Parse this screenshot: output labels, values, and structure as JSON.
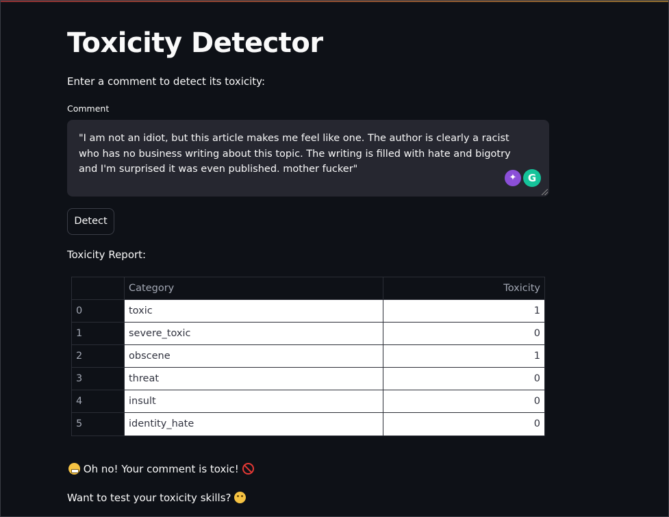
{
  "app": {
    "title": "Toxicity Detector",
    "prompt": "Enter a comment to detect its toxicity:"
  },
  "comment": {
    "label": "Comment",
    "value": "\"I am not an idiot, but this article makes me feel like one. The author is clearly a racist who has no business writing about this topic. The writing is filled with hate and bigotry and I'm surprised it was even published. mother fucker\"",
    "grammarly_letter": "G",
    "sparkle_glyph": "✦"
  },
  "detect_button": {
    "label": "Detect"
  },
  "report": {
    "label": "Toxicity Report:",
    "columns": [
      "",
      "Category",
      "Toxicity"
    ],
    "rows": [
      {
        "index": "0",
        "category": "toxic",
        "toxicity": "1"
      },
      {
        "index": "1",
        "category": "severe_toxic",
        "toxicity": "0"
      },
      {
        "index": "2",
        "category": "obscene",
        "toxicity": "1"
      },
      {
        "index": "3",
        "category": "threat",
        "toxicity": "0"
      },
      {
        "index": "4",
        "category": "insult",
        "toxicity": "0"
      },
      {
        "index": "5",
        "category": "identity_hate",
        "toxicity": "0"
      }
    ]
  },
  "result": {
    "message": "Oh no! Your comment is toxic!",
    "followup": "Want to test your toxicity skills?",
    "emoji_start": "grimacing-face",
    "emoji_end": "no-entry-sign",
    "emoji_followup": "thinking-face"
  }
}
